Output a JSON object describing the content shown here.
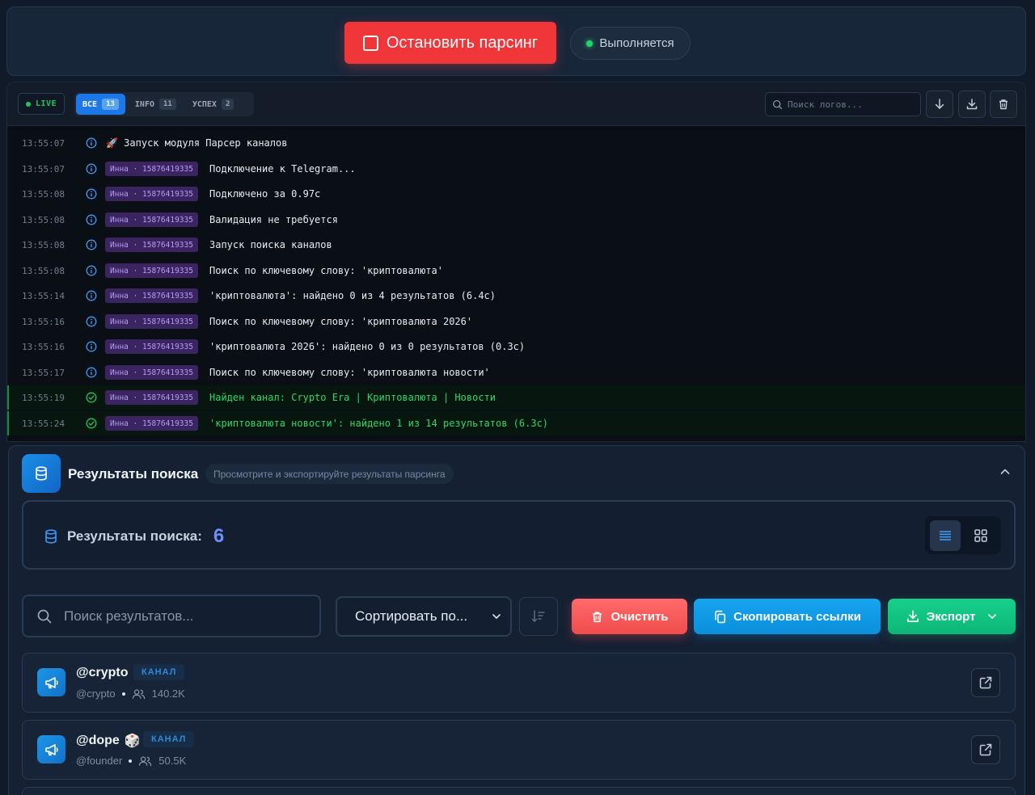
{
  "controls": {
    "stop_label": "Остановить парсинг",
    "status_label": "Выполняется"
  },
  "log": {
    "live_label": "LIVE",
    "filters": [
      {
        "label": "ВСЕ",
        "count": "13"
      },
      {
        "label": "INFO",
        "count": "11"
      },
      {
        "label": "УСПЕХ",
        "count": "2"
      }
    ],
    "search_placeholder": "Поиск логов...",
    "rows": [
      {
        "time": "13:55:07",
        "level": "info",
        "tag": "",
        "message": "🚀 Запуск модуля Парсер каналов"
      },
      {
        "time": "13:55:07",
        "level": "info",
        "tag": "Инна · 15876419335",
        "message": "Подключение к Telegram..."
      },
      {
        "time": "13:55:08",
        "level": "info",
        "tag": "Инна · 15876419335",
        "message": "Подключено за 0.97с"
      },
      {
        "time": "13:55:08",
        "level": "info",
        "tag": "Инна · 15876419335",
        "message": "Валидация не требуется"
      },
      {
        "time": "13:55:08",
        "level": "info",
        "tag": "Инна · 15876419335",
        "message": "Запуск поиска каналов"
      },
      {
        "time": "13:55:08",
        "level": "info",
        "tag": "Инна · 15876419335",
        "message": "Поиск по ключевому слову: 'криптовалюта'"
      },
      {
        "time": "13:55:14",
        "level": "info",
        "tag": "Инна · 15876419335",
        "message": "'криптовалюта': найдено 0 из 4 результатов (6.4с)"
      },
      {
        "time": "13:55:16",
        "level": "info",
        "tag": "Инна · 15876419335",
        "message": "Поиск по ключевому слову: 'криптовалюта 2026'"
      },
      {
        "time": "13:55:16",
        "level": "info",
        "tag": "Инна · 15876419335",
        "message": "'криптовалюта 2026': найдено 0 из 0 результатов (0.3с)"
      },
      {
        "time": "13:55:17",
        "level": "info",
        "tag": "Инна · 15876419335",
        "message": "Поиск по ключевому слову: 'криптовалюта новости'"
      },
      {
        "time": "13:55:19",
        "level": "success",
        "tag": "Инна · 15876419335",
        "message": "Найден канал: Crypto Era | Криптовалюта | Новости"
      },
      {
        "time": "13:55:24",
        "level": "success",
        "tag": "Инна · 15876419335",
        "message": "'криптовалюта новости': найдено 1 из 14 результатов (6.3с)"
      }
    ]
  },
  "results": {
    "title": "Результаты поиска",
    "subtitle": "Просмотрите и экспортируйте результаты парсинга",
    "count_label": "Результаты поиска:",
    "count": "6",
    "search_placeholder": "Поиск результатов...",
    "sort_label": "Сортировать по...",
    "clear_label": "Очистить",
    "copy_label": "Скопировать ссылки",
    "export_label": "Экспорт",
    "items": [
      {
        "name": "@crypto",
        "emoji": "",
        "type": "КАНАЛ",
        "handle": "@crypto",
        "members": "140.2K"
      },
      {
        "name": "@dope",
        "emoji": "🎲",
        "type": "КАНАЛ",
        "handle": "@founder",
        "members": "50.5K"
      }
    ]
  }
}
